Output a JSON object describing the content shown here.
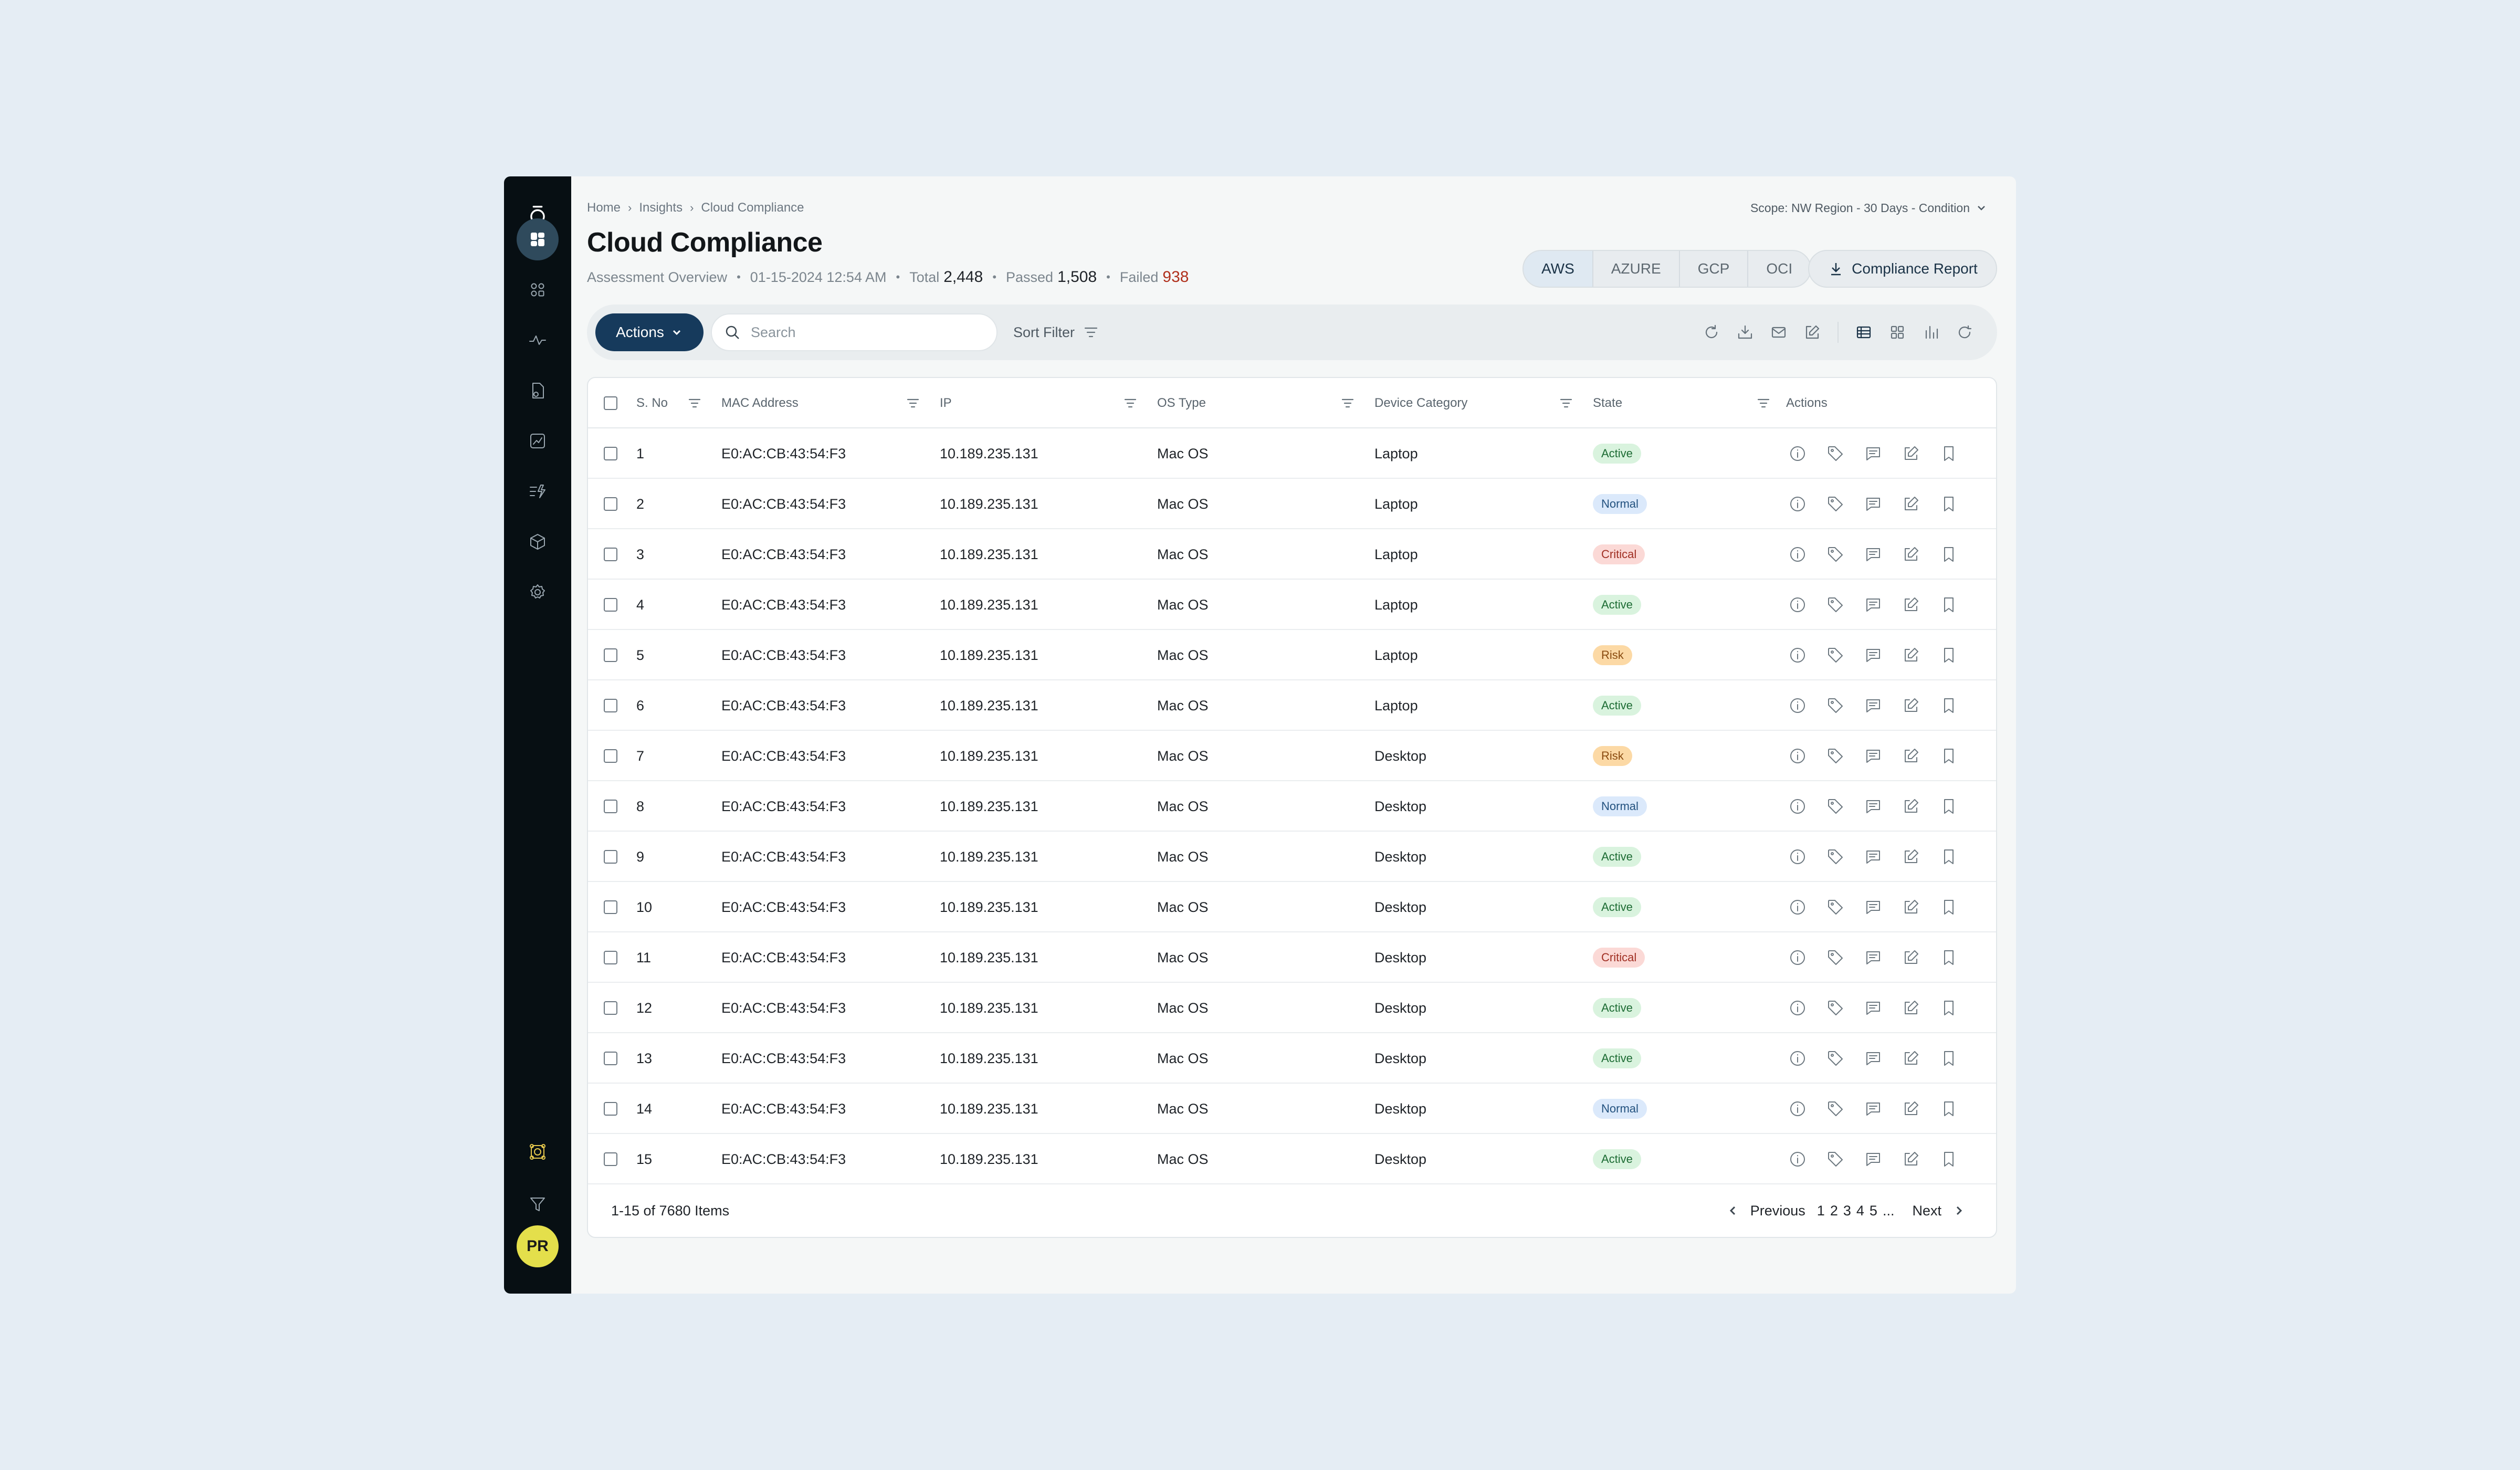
{
  "breadcrumb": {
    "home": "Home",
    "insights": "Insights",
    "current": "Cloud Compliance"
  },
  "scope": "Scope: NW Region - 30 Days - Condition",
  "page_title": "Cloud Compliance",
  "meta": {
    "label": "Assessment Overview",
    "date": "01-15-2024 12:54 AM",
    "total_label": "Total",
    "total": "2,448",
    "passed_label": "Passed",
    "passed": "1,508",
    "failed_label": "Failed",
    "failed": "938"
  },
  "cloud_tabs": [
    "AWS",
    "AZURE",
    "GCP",
    "OCI"
  ],
  "selected_cloud": "AWS",
  "report_button": "Compliance Report",
  "toolbar": {
    "actions": "Actions",
    "search_placeholder": "Search",
    "sort_filter": "Sort Filter"
  },
  "columns": [
    "S. No",
    "MAC Address",
    "IP",
    "OS Type",
    "Device Category",
    "State",
    "Actions"
  ],
  "rows": [
    {
      "sno": "1",
      "mac": "E0:AC:CB:43:54:F3",
      "ip": "10.189.235.131",
      "os": "Mac OS",
      "cat": "Laptop",
      "state": "Active"
    },
    {
      "sno": "2",
      "mac": "E0:AC:CB:43:54:F3",
      "ip": "10.189.235.131",
      "os": "Mac OS",
      "cat": "Laptop",
      "state": "Normal"
    },
    {
      "sno": "3",
      "mac": "E0:AC:CB:43:54:F3",
      "ip": "10.189.235.131",
      "os": "Mac OS",
      "cat": "Laptop",
      "state": "Critical"
    },
    {
      "sno": "4",
      "mac": "E0:AC:CB:43:54:F3",
      "ip": "10.189.235.131",
      "os": "Mac OS",
      "cat": "Laptop",
      "state": "Active"
    },
    {
      "sno": "5",
      "mac": "E0:AC:CB:43:54:F3",
      "ip": "10.189.235.131",
      "os": "Mac OS",
      "cat": "Laptop",
      "state": "Risk"
    },
    {
      "sno": "6",
      "mac": "E0:AC:CB:43:54:F3",
      "ip": "10.189.235.131",
      "os": "Mac OS",
      "cat": "Laptop",
      "state": "Active"
    },
    {
      "sno": "7",
      "mac": "E0:AC:CB:43:54:F3",
      "ip": "10.189.235.131",
      "os": "Mac OS",
      "cat": "Desktop",
      "state": "Risk"
    },
    {
      "sno": "8",
      "mac": "E0:AC:CB:43:54:F3",
      "ip": "10.189.235.131",
      "os": "Mac OS",
      "cat": "Desktop",
      "state": "Normal"
    },
    {
      "sno": "9",
      "mac": "E0:AC:CB:43:54:F3",
      "ip": "10.189.235.131",
      "os": "Mac OS",
      "cat": "Desktop",
      "state": "Active"
    },
    {
      "sno": "10",
      "mac": "E0:AC:CB:43:54:F3",
      "ip": "10.189.235.131",
      "os": "Mac OS",
      "cat": "Desktop",
      "state": "Active"
    },
    {
      "sno": "11",
      "mac": "E0:AC:CB:43:54:F3",
      "ip": "10.189.235.131",
      "os": "Mac OS",
      "cat": "Desktop",
      "state": "Critical"
    },
    {
      "sno": "12",
      "mac": "E0:AC:CB:43:54:F3",
      "ip": "10.189.235.131",
      "os": "Mac OS",
      "cat": "Desktop",
      "state": "Active"
    },
    {
      "sno": "13",
      "mac": "E0:AC:CB:43:54:F3",
      "ip": "10.189.235.131",
      "os": "Mac OS",
      "cat": "Desktop",
      "state": "Active"
    },
    {
      "sno": "14",
      "mac": "E0:AC:CB:43:54:F3",
      "ip": "10.189.235.131",
      "os": "Mac OS",
      "cat": "Desktop",
      "state": "Normal"
    },
    {
      "sno": "15",
      "mac": "E0:AC:CB:43:54:F3",
      "ip": "10.189.235.131",
      "os": "Mac OS",
      "cat": "Desktop",
      "state": "Active"
    }
  ],
  "footer": {
    "count": "1-15 of 7680 Items",
    "previous": "Previous",
    "pages": [
      "1",
      "2",
      "3",
      "4",
      "5"
    ],
    "ellipsis": "...",
    "next": "Next"
  },
  "avatar": "PR",
  "colors": {
    "sidebar": "#070f13",
    "accent": "#163a5c",
    "failed": "#b0301c",
    "avatar": "#e4df4b"
  }
}
